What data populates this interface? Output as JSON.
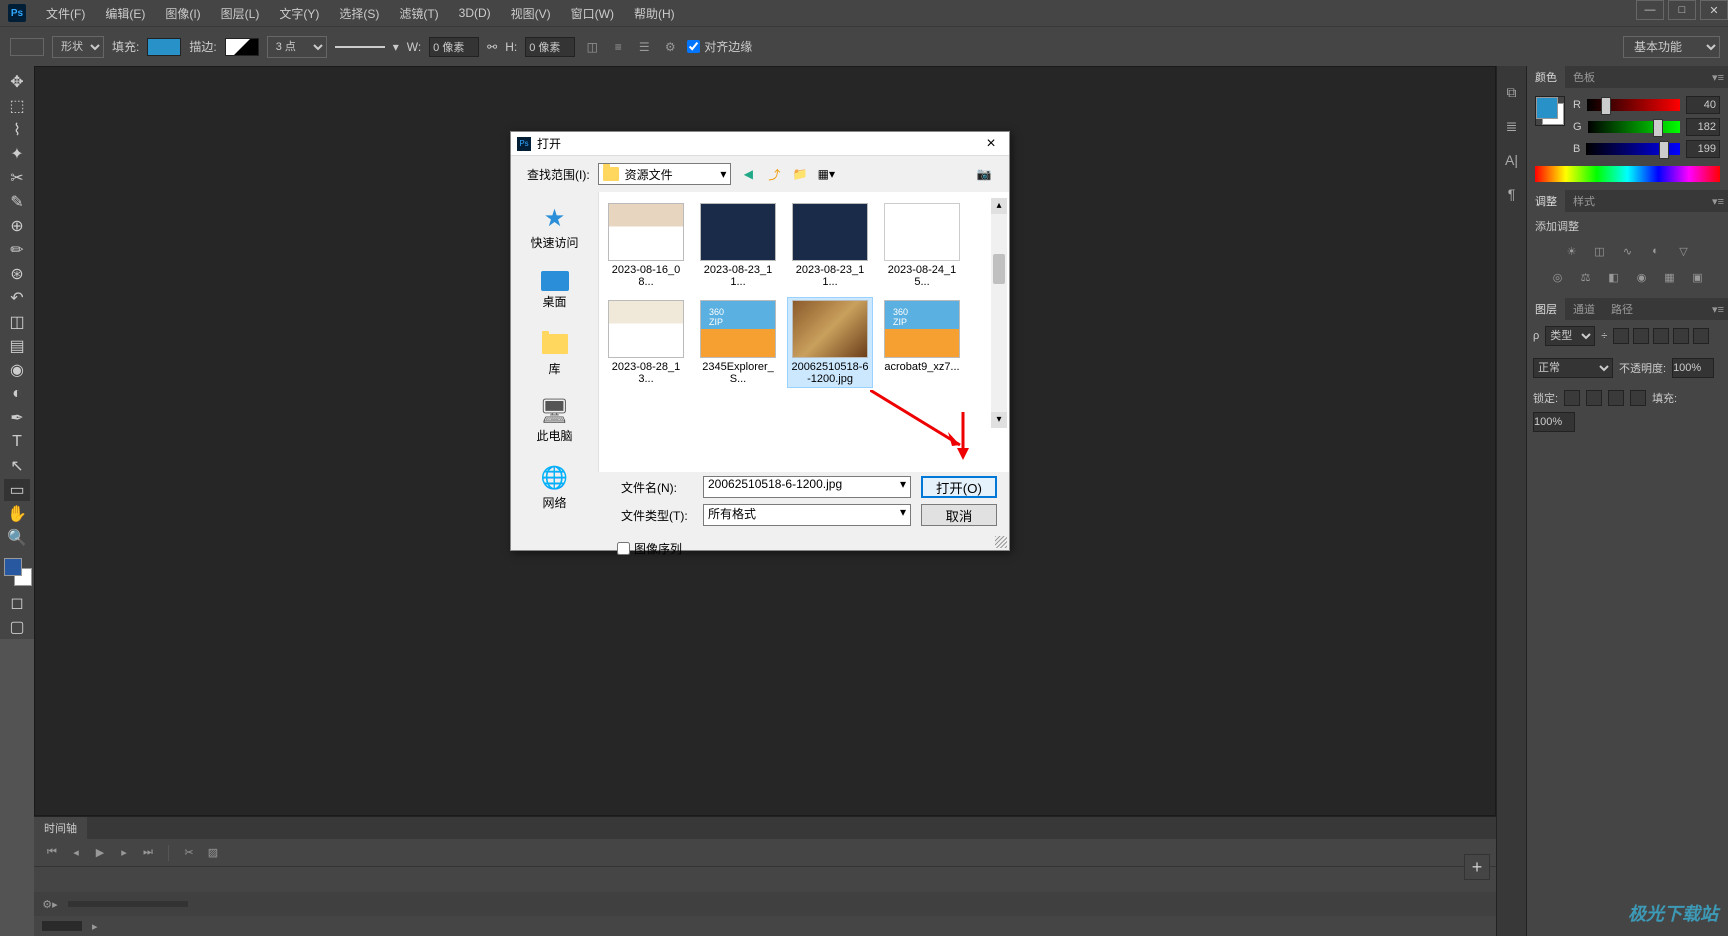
{
  "menubar": {
    "items": [
      "文件(F)",
      "编辑(E)",
      "图像(I)",
      "图层(L)",
      "文字(Y)",
      "选择(S)",
      "滤镜(T)",
      "3D(D)",
      "视图(V)",
      "窗口(W)",
      "帮助(H)"
    ]
  },
  "optbar": {
    "shape": "形状",
    "fill": "填充:",
    "stroke": "描边:",
    "stroke_width": "3 点",
    "w_label": "W:",
    "w_val": "0 像素",
    "h_label": "H:",
    "h_val": "0 像素",
    "align_edges": "对齐边缘",
    "workspace": "基本功能"
  },
  "dialog": {
    "title": "打开",
    "lookin_label": "查找范围(I):",
    "lookin_value": "资源文件",
    "sidebar": [
      {
        "label": "快速访问",
        "icon": "star"
      },
      {
        "label": "桌面",
        "icon": "desktop"
      },
      {
        "label": "库",
        "icon": "library"
      },
      {
        "label": "此电脑",
        "icon": "computer"
      },
      {
        "label": "网络",
        "icon": "network"
      }
    ],
    "files": [
      {
        "name": "2023-08-16_08...",
        "kind": "photo1"
      },
      {
        "name": "2023-08-23_11...",
        "kind": "code"
      },
      {
        "name": "2023-08-23_11...",
        "kind": "code"
      },
      {
        "name": "2023-08-24_15...",
        "kind": "doc"
      },
      {
        "name": "2023-08-28_13...",
        "kind": "photo2"
      },
      {
        "name": "2345Explorer_S...",
        "kind": "zip"
      },
      {
        "name": "20062510518-6-1200.jpg",
        "kind": "food",
        "selected": true
      },
      {
        "name": "acrobat9_xz7...",
        "kind": "zip"
      }
    ],
    "filename_label": "文件名(N):",
    "filename_value": "20062510518-6-1200.jpg",
    "filetype_label": "文件类型(T):",
    "filetype_value": "所有格式",
    "open_btn": "打开(O)",
    "cancel_btn": "取消",
    "sequence_label": "图像序列"
  },
  "color_panel": {
    "tab1": "颜色",
    "tab2": "色板",
    "r_label": "R",
    "r_val": "40",
    "g_label": "G",
    "g_val": "182",
    "b_label": "B",
    "b_val": "199"
  },
  "adjustments_panel": {
    "tab1": "调整",
    "tab2": "样式",
    "heading": "添加调整"
  },
  "layers_panel": {
    "tab1": "图层",
    "tab2": "通道",
    "tab3": "路径",
    "kind": "类型",
    "blend": "正常",
    "opacity_label": "不透明度:",
    "opacity_val": "100%",
    "lock_label": "锁定:",
    "fill_label": "填充:",
    "fill_val": "100%"
  },
  "timeline": {
    "tab": "时间轴"
  },
  "watermark": "极光下载站"
}
